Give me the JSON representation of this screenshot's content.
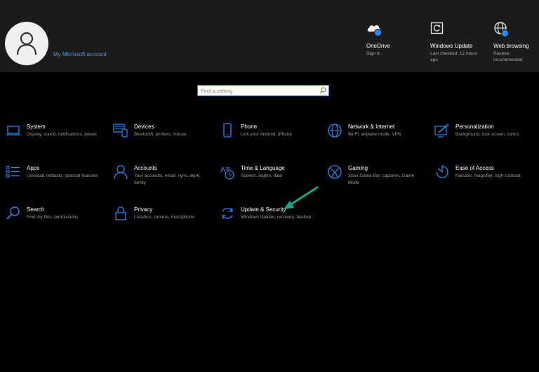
{
  "account": {
    "link_label": "My Microsoft account"
  },
  "header_items": [
    {
      "icon": "onedrive-icon",
      "title": "OneDrive",
      "sub": "Sign In"
    },
    {
      "icon": "windows-update-icon",
      "title": "Windows Update",
      "sub": "Last checked: 12 hours ago"
    },
    {
      "icon": "web-browsing-icon",
      "title": "Web browsing",
      "sub": "Restore recommended"
    }
  ],
  "search": {
    "placeholder": "Find a setting"
  },
  "categories": [
    {
      "icon": "laptop-icon",
      "title": "System",
      "desc": "Display, sound, notifications, power"
    },
    {
      "icon": "devices-icon",
      "title": "Devices",
      "desc": "Bluetooth, printers, mouse"
    },
    {
      "icon": "phone-icon",
      "title": "Phone",
      "desc": "Link your Android, iPhone"
    },
    {
      "icon": "globe-icon",
      "title": "Network & Internet",
      "desc": "Wi-Fi, airplane mode, VPN"
    },
    {
      "icon": "personalization-icon",
      "title": "Personalization",
      "desc": "Background, lock screen, colors"
    },
    {
      "icon": "apps-icon",
      "title": "Apps",
      "desc": "Uninstall, defaults, optional features"
    },
    {
      "icon": "person-icon",
      "title": "Accounts",
      "desc": "Your accounts, email, sync, work, family"
    },
    {
      "icon": "time-language-icon",
      "title": "Time & Language",
      "desc": "Speech, region, date"
    },
    {
      "icon": "xbox-icon",
      "title": "Gaming",
      "desc": "Xbox Game Bar, captures, Game Mode"
    },
    {
      "icon": "ease-of-access-icon",
      "title": "Ease of Access",
      "desc": "Narrator, magnifier, high contrast"
    },
    {
      "icon": "search-icon",
      "title": "Search",
      "desc": "Find my files, permissions"
    },
    {
      "icon": "lock-icon",
      "title": "Privacy",
      "desc": "Location, camera, microphone"
    },
    {
      "icon": "sync-icon",
      "title": "Update & Security",
      "desc": "Windows Update, recovery, backup"
    }
  ],
  "colors": {
    "accent": "#2e86f0",
    "annotation_arrow": "#17a48c",
    "header_bg": "#1b1b1b"
  }
}
